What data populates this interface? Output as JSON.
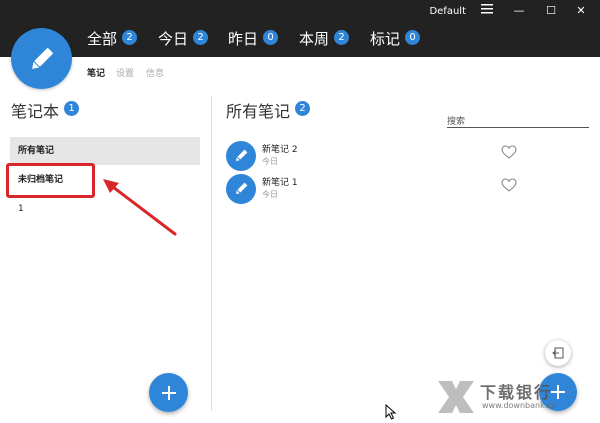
{
  "window": {
    "title": "Default",
    "menu_icon": "hamburger-icon",
    "minimize": "—",
    "maximize": "☐",
    "close": "✕"
  },
  "tabs": [
    {
      "label": "全部",
      "count": "2"
    },
    {
      "label": "今日",
      "count": "2"
    },
    {
      "label": "昨日",
      "count": "0"
    },
    {
      "label": "本周",
      "count": "2"
    },
    {
      "label": "标记",
      "count": "0"
    }
  ],
  "subtabs": [
    "笔记",
    "设置",
    "信息"
  ],
  "notebooks": {
    "title": "笔记本",
    "count": "1",
    "items": [
      "所有笔记",
      "未归档笔记",
      "1"
    ]
  },
  "notes": {
    "title": "所有笔记",
    "count": "2",
    "search_placeholder": "搜索",
    "items": [
      {
        "title": "新笔记 2",
        "date": "今日"
      },
      {
        "title": "新笔记 1",
        "date": "今日"
      }
    ]
  },
  "watermark": {
    "main": "下载银行",
    "sub": "www.downbank.cn"
  },
  "colors": {
    "accent": "#2f86d8",
    "topbar": "#222222",
    "highlight": "#d8262a"
  }
}
